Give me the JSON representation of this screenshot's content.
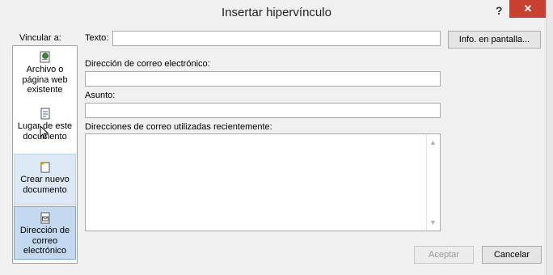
{
  "window": {
    "title": "Insertar hipervínculo",
    "help": "?",
    "close": "✕"
  },
  "link_to": {
    "label": "Vincular a:"
  },
  "sidebar": {
    "items": [
      {
        "line1": "Archivo o",
        "line2": "página web",
        "line3": "existente"
      },
      {
        "line1": "Lugar de este",
        "line2": "documento",
        "line3": ""
      },
      {
        "line1": "Crear nuevo",
        "line2": "documento",
        "line3": ""
      },
      {
        "line1": "Dirección de",
        "line2": "correo",
        "line3": "electrónico"
      }
    ]
  },
  "text_field": {
    "label": "Texto:",
    "value": ""
  },
  "screentip_button": "Info. en pantalla...",
  "email": {
    "label": "Dirección de correo electrónico:",
    "value": ""
  },
  "subject": {
    "label": "Asunto:",
    "value": ""
  },
  "recent": {
    "label": "Direcciones de correo utilizadas recientemente:"
  },
  "buttons": {
    "ok": "Aceptar",
    "cancel": "Cancelar"
  }
}
